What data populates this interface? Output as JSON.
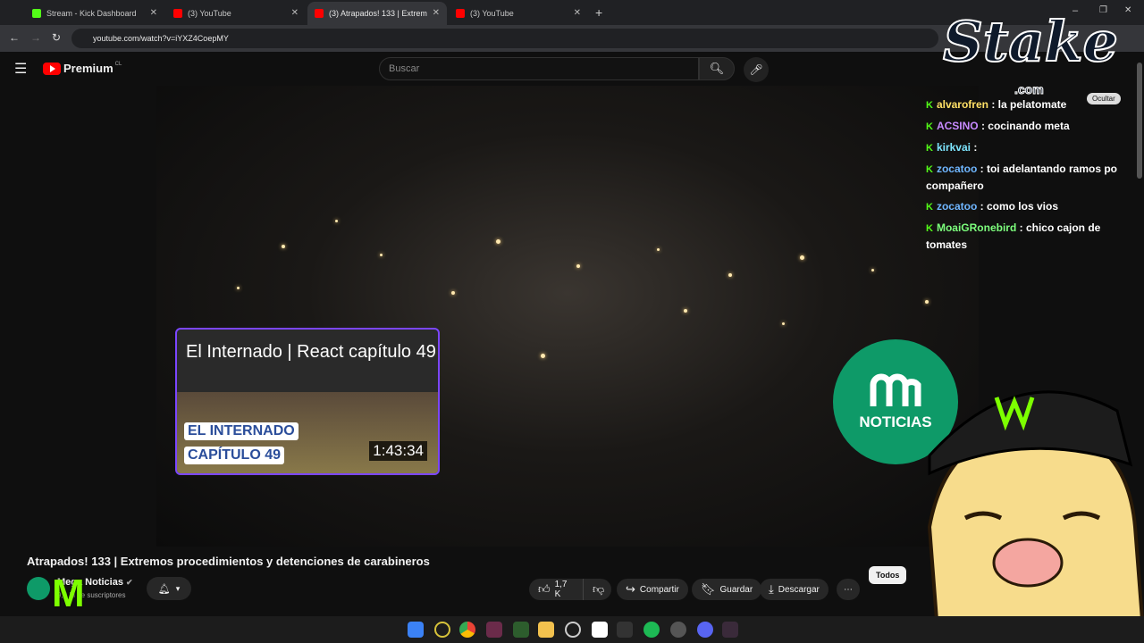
{
  "tabs": [
    {
      "title": "Stream - Kick Dashboard",
      "active": false
    },
    {
      "title": "(3) YouTube",
      "active": false
    },
    {
      "title": "(3) Atrapados! 133 | Extrem",
      "active": true
    },
    {
      "title": "(3) YouTube",
      "active": false
    }
  ],
  "address": {
    "url": "youtube.com/watch?v=iYXZ4CoepMY"
  },
  "youtube": {
    "logo_label": "Premium",
    "logo_region": "CL",
    "search_placeholder": "Buscar"
  },
  "react_card": {
    "title": "El Internado | React capítulo 49",
    "badge_line1": "EL INTERNADO",
    "badge_line2": "CAPÍTULO 49",
    "duration": "1:43:34"
  },
  "mega": {
    "label": "NOTICIAS"
  },
  "overlay": {
    "stake_text": "Stake",
    "stake_sub": ".com",
    "ocultar": "Ocultar"
  },
  "chat": [
    {
      "user": "alvarofren",
      "message": "la pelatomate",
      "user_color": "#ffe066"
    },
    {
      "user": "ACSINO",
      "message": "cocinando meta",
      "user_color": "#c78aff"
    },
    {
      "user": "kirkvai",
      "message": "",
      "user_color": "#7ee6ff"
    },
    {
      "user": "zocatoo",
      "message": "toi adelantando ramos po compañero",
      "user_color": "#6fb6ff"
    },
    {
      "user": "zocatoo",
      "message": "como los vios",
      "user_color": "#6fb6ff"
    },
    {
      "user": "MoaiGRonebird",
      "message": "chico cajon de tomates",
      "user_color": "#7dff7d"
    }
  ],
  "video_info": {
    "title": "Atrapados! 133 | Extremos procedimientos y detenciones de carabineros",
    "channel": "Mega Noticias",
    "subs": "9,2 M de suscriptores",
    "likes": "1,7 K",
    "share": "Compartir",
    "save": "Guardar",
    "download": "Descargar",
    "chip_all": "Todos"
  },
  "colors": {
    "kick_green": "#53fc18",
    "mega_green": "#0e9a68",
    "react_border": "#7b46ff"
  }
}
